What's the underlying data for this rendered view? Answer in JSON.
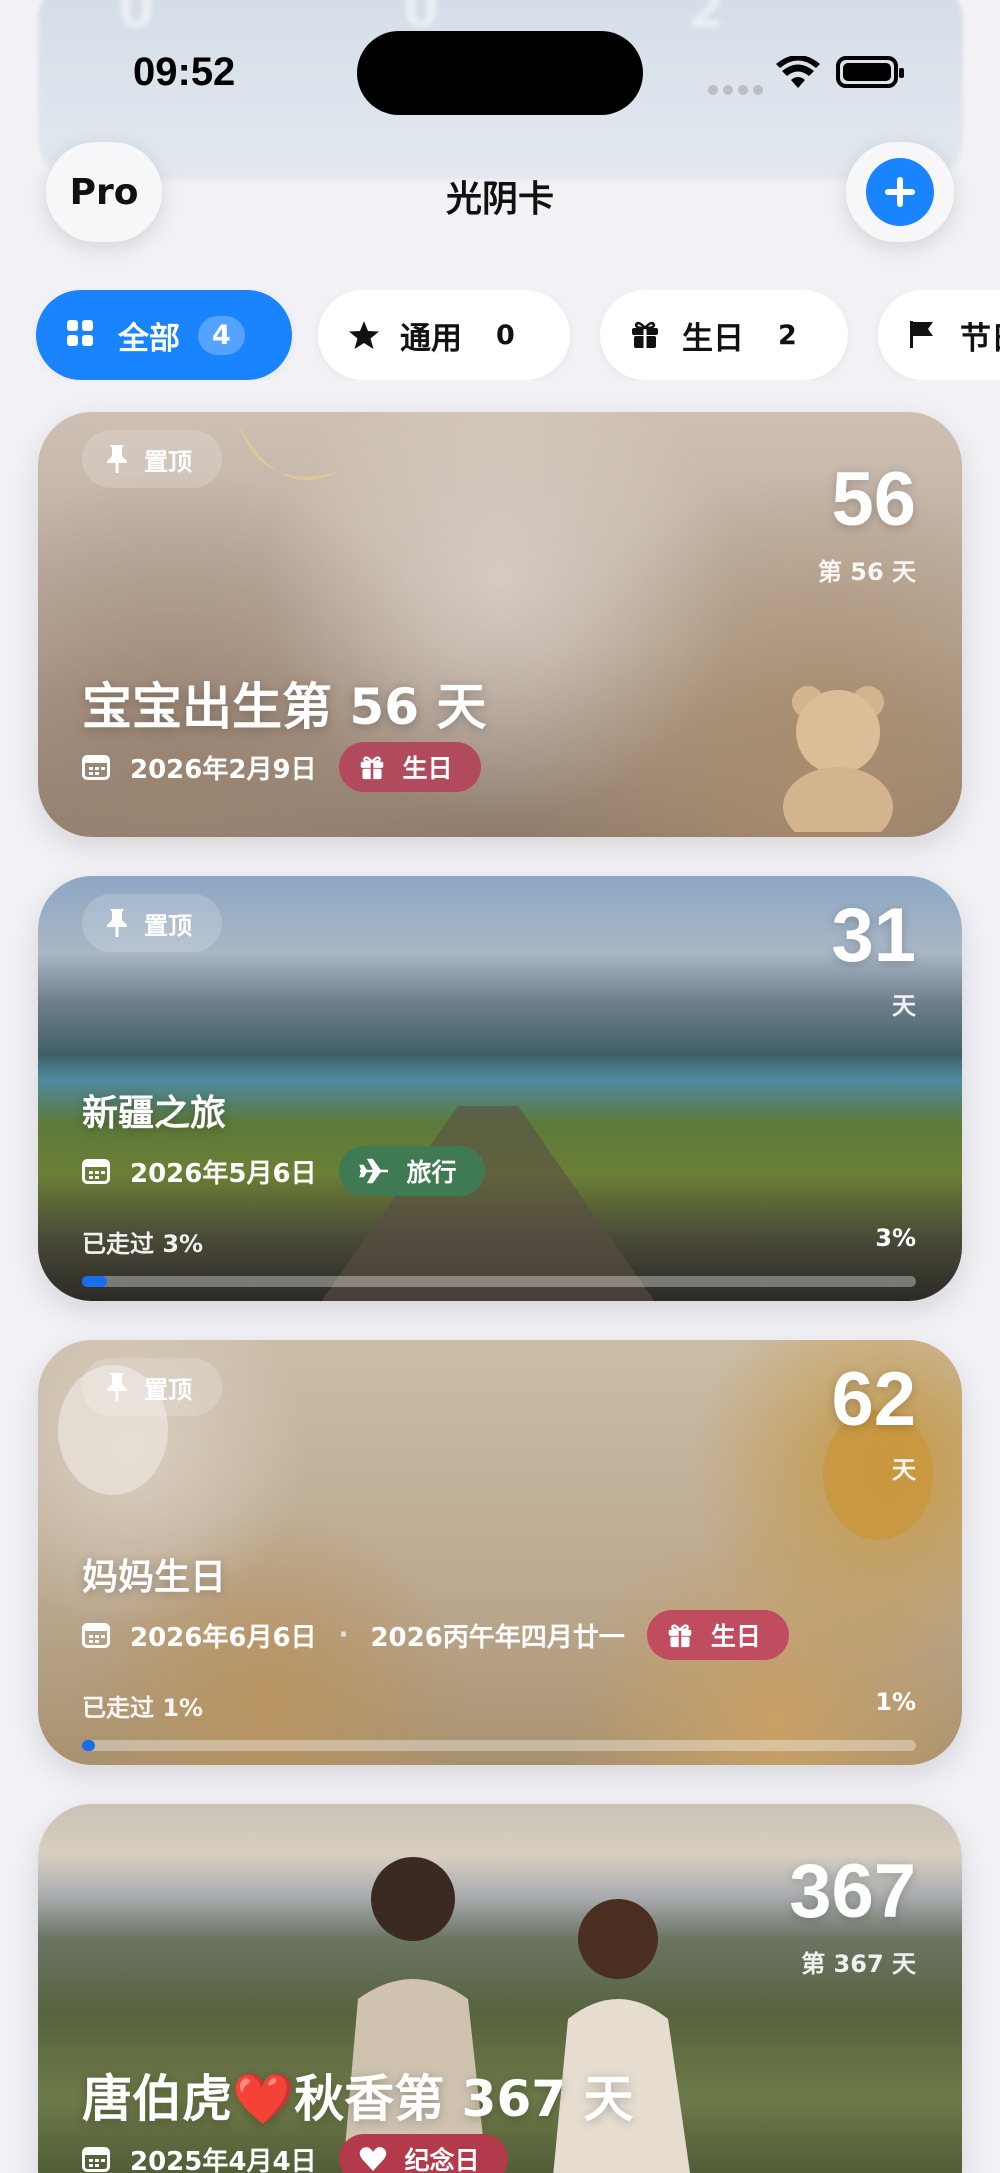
{
  "status_bar": {
    "time": "09:52"
  },
  "background_ghost_numbers": [
    "0",
    "0",
    "2"
  ],
  "header": {
    "pro_label": "Pro",
    "title": "光阴卡"
  },
  "filters": [
    {
      "label": "全部",
      "count": "4",
      "icon": "grid-icon",
      "active": true
    },
    {
      "label": "通用",
      "count": "0",
      "icon": "star-icon",
      "active": false
    },
    {
      "label": "生日",
      "count": "2",
      "icon": "gift-icon",
      "active": false
    },
    {
      "label": "节日",
      "icon": "flag-icon",
      "active": false
    }
  ],
  "cards": [
    {
      "pinned_label": "置顶",
      "big_number": "56",
      "sub_label": "第 56 天",
      "title": "宝宝出生第 56 天",
      "date": "2026年2月9日",
      "tag": {
        "label": "生日",
        "icon": "gift-icon",
        "color": "#b24a5e"
      }
    },
    {
      "pinned_label": "置顶",
      "big_number": "31",
      "sub_label": "天",
      "title": "新疆之旅",
      "date": "2026年5月6日",
      "tag": {
        "label": "旅行",
        "icon": "airplane-icon",
        "color": "#3f7a52"
      },
      "progress_label": "已走过 3%",
      "progress_pct": "3%",
      "progress_value": 0.03
    },
    {
      "pinned_label": "置顶",
      "big_number": "62",
      "sub_label": "天",
      "title": "妈妈生日",
      "date": "2026年6月6日",
      "lunar_date": "2026丙午年四月廿一",
      "separator": "·",
      "tag": {
        "label": "生日",
        "icon": "gift-icon",
        "color": "#c04c60"
      },
      "progress_label": "已走过 1%",
      "progress_pct": "1%",
      "progress_value": 0.01
    },
    {
      "big_number": "367",
      "sub_label": "第 367 天",
      "title": "唐伯虎❤️秋香第 367 天",
      "date": "2025年4月4日",
      "tag": {
        "label": "纪念日",
        "icon": "heart-icon",
        "color": "#b23a4a"
      }
    }
  ],
  "colors": {
    "accent": "#1a84ff",
    "background": "#f2f2f6"
  }
}
